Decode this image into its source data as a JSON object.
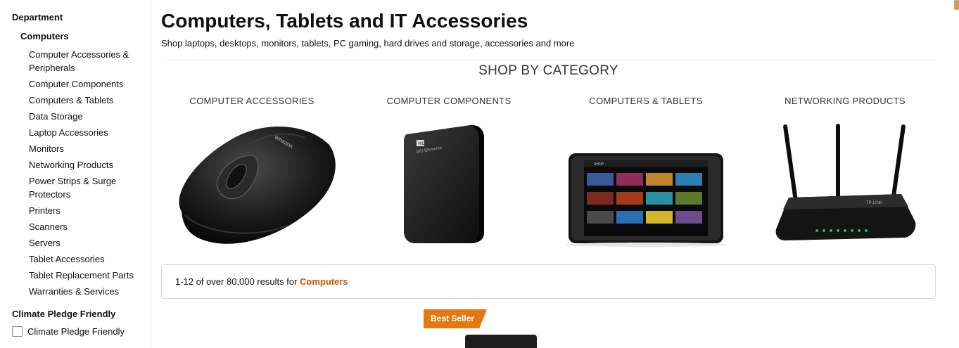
{
  "sidebar": {
    "department_heading": "Department",
    "current_department": "Computers",
    "items": [
      "Computer Accessories & Peripherals",
      "Computer Components",
      "Computers & Tablets",
      "Data Storage",
      "Laptop Accessories",
      "Monitors",
      "Networking Products",
      "Power Strips & Surge Protectors",
      "Printers",
      "Scanners",
      "Servers",
      "Tablet Accessories",
      "Tablet Replacement Parts",
      "Warranties & Services"
    ],
    "climate_heading": "Climate Pledge Friendly",
    "climate_checkbox_label": "Climate Pledge Friendly"
  },
  "main": {
    "title": "Computers, Tablets and IT Accessories",
    "subtitle": "Shop laptops, desktops, monitors, tablets, PC gaming, hard drives and storage, accessories and more",
    "shop_by_heading": "SHOP BY CATEGORY",
    "categories": [
      {
        "label": "COMPUTER ACCESSORIES",
        "icon": "mouse-image"
      },
      {
        "label": "COMPUTER COMPONENTS",
        "icon": "external-hard-drive-image"
      },
      {
        "label": "COMPUTERS & TABLETS",
        "icon": "tablet-image"
      },
      {
        "label": "NETWORKING PRODUCTS",
        "icon": "wifi-router-image"
      }
    ],
    "results": {
      "prefix": "1-12 of over 80,000 results for ",
      "query": "Computers"
    },
    "badge": "Best Seller"
  },
  "colors": {
    "accent": "#c45500",
    "badge": "#e47911",
    "text": "#0f1111"
  }
}
